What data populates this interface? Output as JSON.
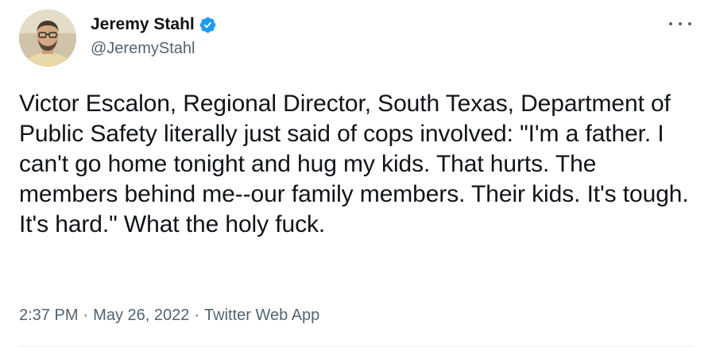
{
  "author": {
    "display_name": "Jeremy Stahl",
    "handle": "@JeremyStahl",
    "verified": true,
    "verified_color": "#1d9bf0"
  },
  "tweet": {
    "text": "Victor Escalon, Regional Director, South Texas, Department of Public Safety literally just said of cops involved: \"I'm a father. I can't go home tonight and hug my kids. That hurts. The members behind me--our family members. Their kids. It's tough. It's hard.\" What the holy fuck.",
    "time": "2:37 PM",
    "date": "May 26, 2022",
    "source": "Twitter Web App",
    "separator": "·"
  },
  "icons": {
    "more": "more-options-icon",
    "verified": "verified-badge-icon"
  },
  "colors": {
    "text": "#0f1419",
    "secondary": "#536471",
    "accent": "#1d9bf0"
  }
}
